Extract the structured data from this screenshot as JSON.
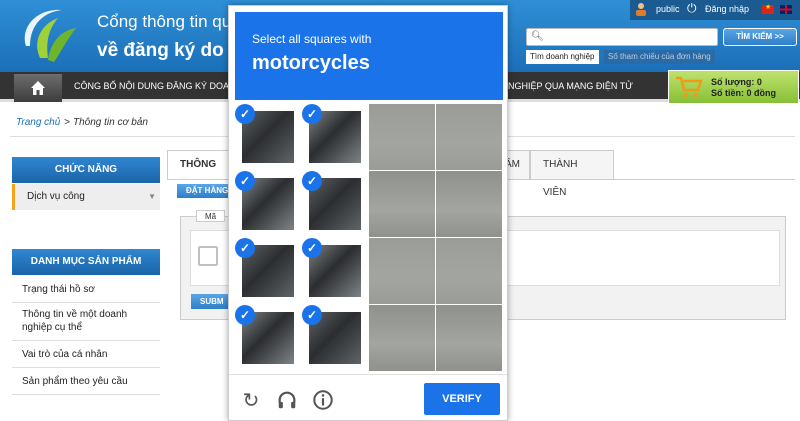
{
  "header": {
    "title_line1": "Cổng thông tin qu",
    "title_line2": "về đăng ký do",
    "user": "public",
    "login": "Đăng nhập",
    "search": {
      "placeholder": "",
      "button": "TÌM KIẾM >>",
      "tabs": [
        "Tìm doanh nghiệp",
        "Số tham chiếu của đơn hàng"
      ]
    }
  },
  "nav": {
    "items": [
      "CÔNG BỐ NỘI DUNG ĐĂNG KÝ DOA",
      "NGHIỆP QUA MẠNG ĐIỆN TỬ"
    ]
  },
  "cart": {
    "qty": "Số lượng: 0",
    "amount": "Số tiền: 0 đồng"
  },
  "breadcrumb": {
    "home": "Trang chủ",
    "sep": ">",
    "current": "Thông tin cơ bản"
  },
  "sidebar": {
    "functions_title": "CHỨC NĂNG",
    "functions": [
      "Dịch vụ công"
    ],
    "products_title": "DANH MỤC SẢN PHẨM",
    "products": [
      "Trạng thái hồ sơ",
      "Thông tin về một doanh nghiệp cụ thể",
      "Vai trò của cá nhân",
      "Sản phẩm theo yêu cầu"
    ]
  },
  "main": {
    "tabs": [
      "THÔNG TI",
      "ÂM",
      "THÀNH VIÊN"
    ],
    "order_button": "ĐẶT HÀNG",
    "fieldset_label": "Mã",
    "submit_button": "SUBM"
  },
  "captcha": {
    "instruction": "Select all squares with",
    "target": "motorcycles",
    "check_glyph": "✓",
    "selected": [
      true,
      true,
      false,
      false,
      true,
      true,
      false,
      false,
      true,
      true,
      false,
      false,
      true,
      true,
      false,
      false
    ],
    "icons": {
      "reload": "reload-icon",
      "audio": "headphones-icon",
      "info": "info-icon"
    },
    "verify": "VERIFY"
  }
}
